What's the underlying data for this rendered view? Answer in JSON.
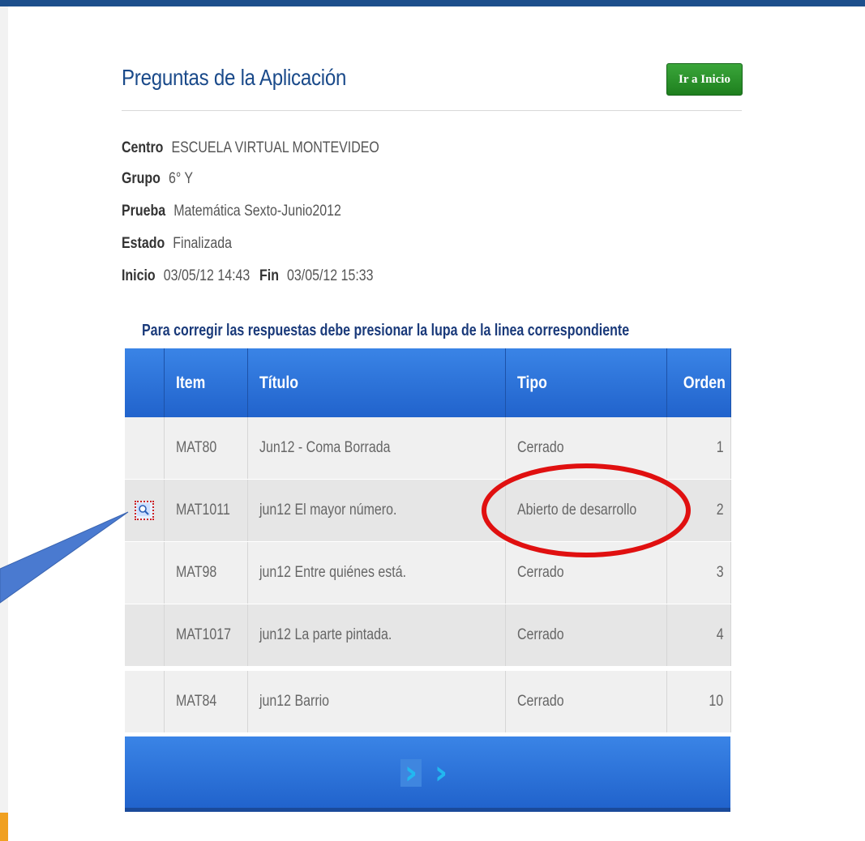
{
  "header": {
    "title": "Preguntas de la Aplicación",
    "home_button": "Ir a Inicio"
  },
  "info": {
    "centro_label": "Centro",
    "centro_value": "ESCUELA VIRTUAL MONTEVIDEO",
    "grupo_label": "Grupo",
    "grupo_value": "6°  Y",
    "prueba_label": "Prueba",
    "prueba_value": "Matemática Sexto-Junio2012",
    "estado_label": "Estado",
    "estado_value": "Finalizada",
    "inicio_label": "Inicio",
    "inicio_value": "03/05/12 14:43",
    "fin_label": "Fin",
    "fin_value": "03/05/12 15:33"
  },
  "instruction": "Para corregir las respuestas debe presionar la lupa de la linea correspondiente",
  "table": {
    "columns": [
      "Item",
      "Título",
      "Tipo",
      "Orden"
    ],
    "rows": [
      {
        "item": "MAT80",
        "titulo": "Jun12 - Coma Borrada",
        "tipo": "Cerrado",
        "orden": "1"
      },
      {
        "item": "MAT1011",
        "titulo": "jun12 El mayor número.",
        "tipo": "Abierto de desarrollo",
        "orden": "2"
      },
      {
        "item": "MAT98",
        "titulo": "jun12 Entre quiénes está.",
        "tipo": "Cerrado",
        "orden": "3"
      },
      {
        "item": "MAT1017",
        "titulo": "jun12 La parte pintada.",
        "tipo": "Cerrado",
        "orden": "4"
      },
      {
        "item": "MAT84",
        "titulo": "jun12 Barrio",
        "tipo": "Cerrado",
        "orden": "10"
      }
    ]
  },
  "pager": {
    "next_glyph": "›",
    "last_glyph": "›"
  },
  "icons": {
    "row_action": "magnifier-icon"
  },
  "colors": {
    "title": "#1a4a8a",
    "header_blue": "#2f74dc",
    "home_button": "#2a952a",
    "highlight_ellipse": "#e01010",
    "callout_arrow": "#4a7ad0"
  }
}
